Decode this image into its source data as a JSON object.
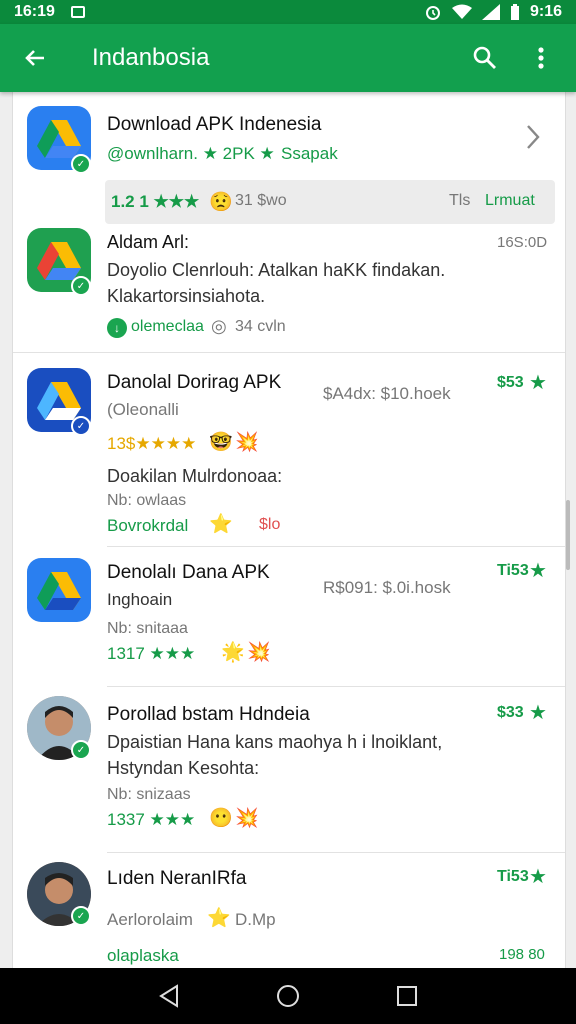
{
  "status": {
    "time": "16:19",
    "clock": "9:16"
  },
  "appbar": {
    "title": "Indanbosia"
  },
  "items": [
    {
      "name": "Download APK Indenesia",
      "meta": "@ownlharn. ★ 2PK ★",
      "meta2": "Ssapak",
      "rating_text": "1.2 1 ★★★",
      "rating_extra": "31 $wo",
      "tag_prefix": "Tls",
      "tag": "Lrmuat"
    },
    {
      "name": "Aldam Arl:",
      "time": "16S:0D",
      "desc1": "Doyolio Clenrlouh: Atalkan haKK findakan.",
      "desc2": "Klakartorsinsiahota.",
      "footer": "olemeclaa",
      "footer2": "34 cvln"
    },
    {
      "name": "Danolal Dorirag APK",
      "sub": "(Oleonalli",
      "mid": "$A4dx: $10.hoek",
      "price": "$53",
      "rating": "13$★★★★",
      "desc1": "Doakilan Mulrdonoaa:",
      "desc2": "Nb: owlaas",
      "footer": "Bovrokrdal",
      "footer_extra": "$lo"
    },
    {
      "name": "Denolalı Dana APK",
      "sub": "Inghoain",
      "mid": "R$091: $.0i.hosk",
      "price": "Ti53",
      "desc1": "Nb: snitaaa",
      "rating": "1317 ★★★"
    },
    {
      "name": "Porollad bstam Hdndeia",
      "price": "$33",
      "desc1": "Dpaistian Hana kans maohya h i lnoiklant,",
      "desc2": "Hstyndan Kesohta:",
      "desc3": "Nb: snizaas",
      "rating": "1337 ★★★"
    },
    {
      "name": "Lıden NeranIRfa",
      "price": "Ti53",
      "desc1": "Aerlorolaim",
      "desc1_extra": "D.Mp",
      "footer": "olaplaska",
      "footer_price": "198 80"
    }
  ],
  "colors": {
    "appbar": "#12a04e",
    "statusbar": "#0b8a3c",
    "accent": "#169b48"
  }
}
